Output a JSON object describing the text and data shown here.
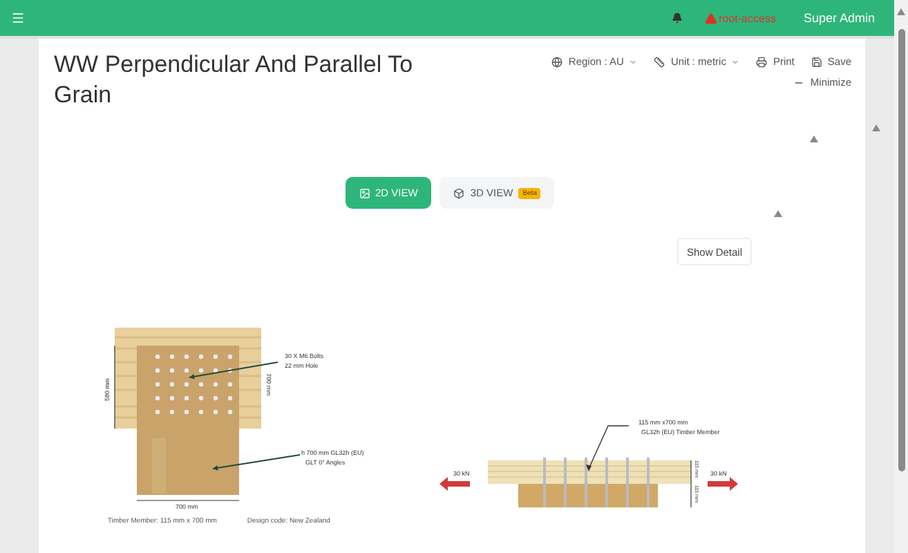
{
  "header": {
    "alert": "root-access",
    "user": "Super Admin"
  },
  "title": "WW Perpendicular And Parallel To Grain",
  "toolbar": [
    {
      "kind": "region",
      "label": "Region : AU",
      "dropdown": true
    },
    {
      "kind": "unit",
      "label": "Unit : metric",
      "dropdown": true
    },
    {
      "kind": "print",
      "label": "Print",
      "dropdown": false
    },
    {
      "kind": "save",
      "label": "Save",
      "dropdown": false
    }
  ],
  "minimize": "Minimize",
  "view_tabs": [
    {
      "label": "2D VIEW",
      "selected": true
    },
    {
      "label": "3D VIEW",
      "selected": false,
      "badge": "Beta"
    }
  ],
  "show_detail": "Show Detail",
  "plan_view": {
    "bolts_label": [
      "30 X M6 Bolts",
      "22 mm Hole"
    ],
    "member_label": [
      "h 700 mm GL32h (EU)",
      "GLT 0° Angles"
    ],
    "dim_left": "580 mm",
    "dim_right": "700 mm",
    "dim_bottom": "700 mm"
  },
  "section_view": {
    "member_label": [
      "115 mm x700 mm",
      "GL32h (EU) Timber Member"
    ],
    "load_left": "30 kN",
    "load_right": "30 kN",
    "dim_top": "115 mm",
    "dim_bottom": "115 mm"
  },
  "footer": [
    "Timber Member: 115 mm x 700 mm",
    "Design code: New Zealand"
  ]
}
